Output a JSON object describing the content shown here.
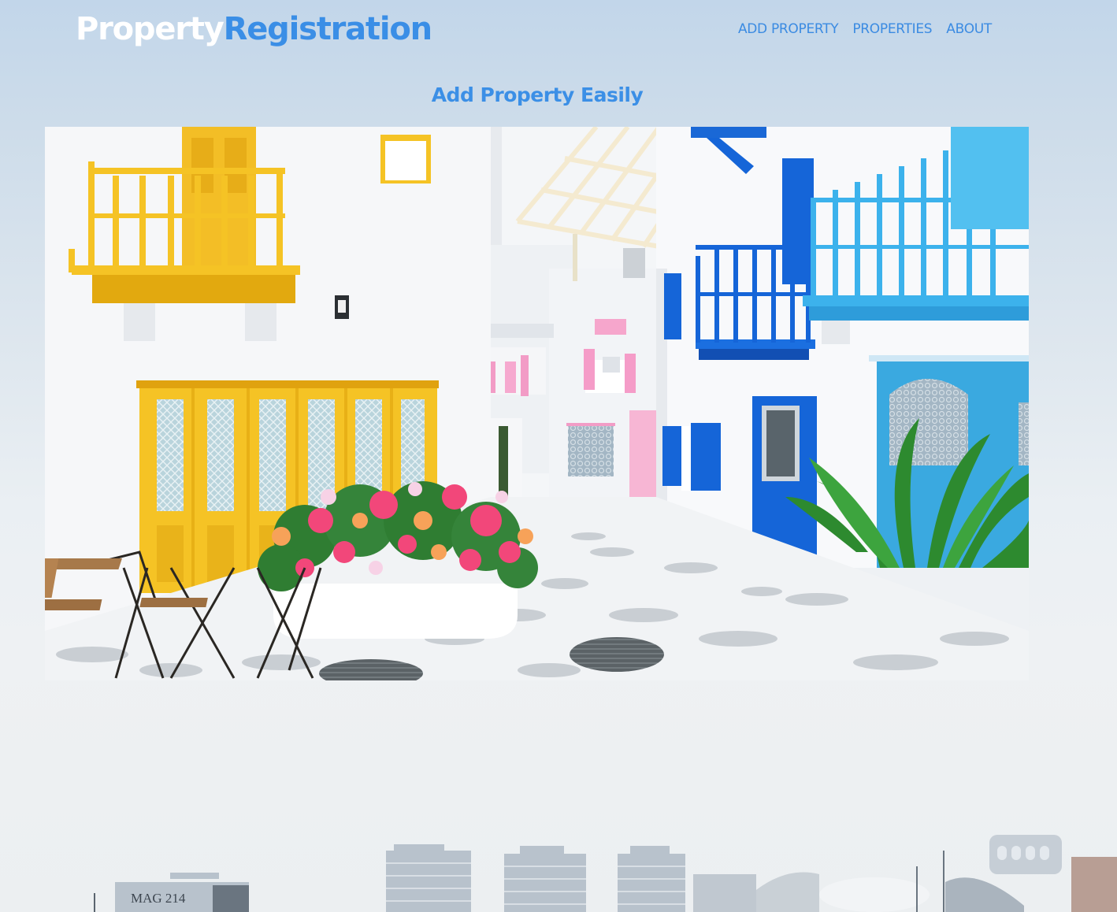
{
  "header": {
    "logo_part1": "Property",
    "logo_part2": "Registration",
    "nav": [
      {
        "label": "ADD PROPERTY"
      },
      {
        "label": "PROPERTIES"
      },
      {
        "label": "ABOUT"
      }
    ]
  },
  "hero": {
    "title": "Add Property Easily"
  },
  "skyline": {
    "building_sign": "MAG 214"
  },
  "colors": {
    "accent": "#3a8ee6",
    "logo_white": "#ffffff",
    "yellow": "#f5c325",
    "blue": "#1565d8",
    "light_blue": "#3cb2ec",
    "pink": "#f28fc0"
  }
}
